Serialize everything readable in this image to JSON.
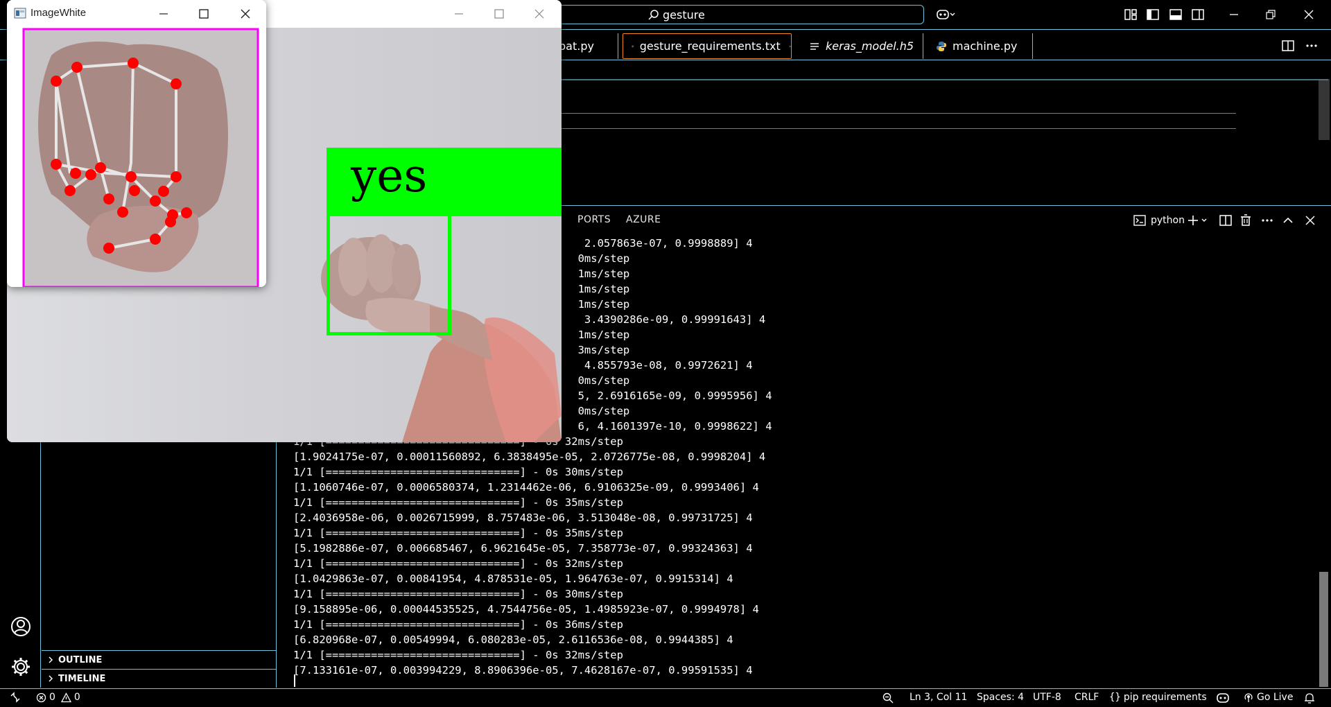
{
  "titlebar": {
    "search_text": "gesture"
  },
  "tabs": [
    {
      "label": "pat.py",
      "italic": false
    },
    {
      "label": "gesture_requirements.txt",
      "italic": false,
      "active": true
    },
    {
      "label": "keras_model.h5",
      "italic": true
    },
    {
      "label": "machine.py",
      "italic": false
    }
  ],
  "panel": {
    "tabs": [
      "PORTS",
      "AZURE"
    ],
    "terminal_name": "python"
  },
  "terminal_lines": [
    "                                             2.057863e-07, 0.9998889] 4",
    "                                            0ms/step",
    "                                            1ms/step",
    "                                            1ms/step",
    "                                            1ms/step",
    "                                             3.4390286e-09, 0.99991643] 4",
    "                                            1ms/step",
    "                                            3ms/step",
    "                                             4.855793e-08, 0.9972621] 4",
    "                                            0ms/step",
    "                                            5, 2.6916165e-09, 0.9995956] 4",
    "                                            0ms/step",
    "                                            6, 4.1601397e-10, 0.9998622] 4",
    "1/1 [==============================] - 0s 32ms/step",
    "[1.9024175e-07, 0.00011560892, 6.3838495e-05, 2.0726775e-08, 0.9998204] 4",
    "1/1 [==============================] - 0s 30ms/step",
    "[1.1060746e-07, 0.0006580374, 1.2314462e-06, 6.9106325e-09, 0.9993406] 4",
    "1/1 [==============================] - 0s 35ms/step",
    "[2.4036958e-06, 0.0026715999, 8.757483e-06, 3.513048e-08, 0.99731725] 4",
    "1/1 [==============================] - 0s 35ms/step",
    "[5.1982886e-07, 0.006685467, 6.9621645e-05, 7.358773e-07, 0.99324363] 4",
    "1/1 [==============================] - 0s 32ms/step",
    "[1.0429863e-07, 0.00841954, 4.878531e-05, 1.964763e-07, 0.9915314] 4",
    "1/1 [==============================] - 0s 30ms/step",
    "[9.158895e-06, 0.00044535525, 4.7544756e-05, 1.4985923e-07, 0.9994978] 4",
    "1/1 [==============================] - 0s 36ms/step",
    "[6.820968e-07, 0.00549994, 6.080283e-05, 2.6116536e-08, 0.9944385] 4",
    "1/1 [==============================] - 0s 32ms/step",
    "[7.133161e-07, 0.003994229, 8.8906396e-05, 7.4628167e-07, 0.99591535] 4"
  ],
  "sidebar": {
    "sections": [
      "OUTLINE",
      "TIMELINE"
    ]
  },
  "statusbar": {
    "errors": "0",
    "warnings": "0",
    "position": "Ln 3, Col 11",
    "spaces": "Spaces: 4",
    "encoding": "UTF-8",
    "eol": "CRLF",
    "language": "pip requirements",
    "golive": "Go Live"
  },
  "camera_window": {
    "label": "yes"
  },
  "imagewhite_window": {
    "title": "ImageWhite"
  },
  "colors": {
    "accent_border": "#6fc3df",
    "active_tab_border": "#f38518",
    "detection_green": "#00ff00",
    "landmark_red": "#ff0000",
    "crop_magenta": "#ff00ff"
  }
}
